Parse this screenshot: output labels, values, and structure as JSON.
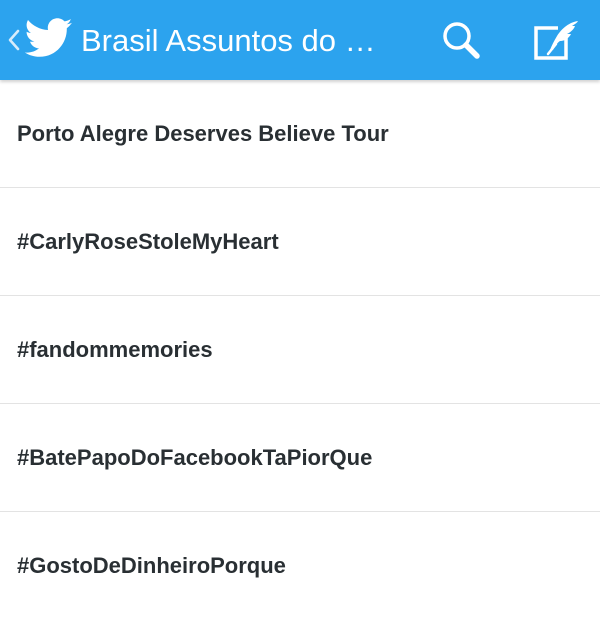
{
  "app_bar": {
    "title": "Brasil Assuntos do M...",
    "background_color": "#2ca3ee",
    "icons": {
      "back": "chevron-left-icon",
      "logo": "twitter-bird-icon",
      "search": "search-icon",
      "compose": "compose-tweet-icon"
    }
  },
  "trends": [
    {
      "label": "Porto Alegre Deserves Believe Tour"
    },
    {
      "label": "#CarlyRoseStoleMyHeart"
    },
    {
      "label": "#fandommemories"
    },
    {
      "label": "#BatePapoDoFacebookTaPiorQue"
    },
    {
      "label": "#GostoDeDinheiroPorque"
    }
  ]
}
